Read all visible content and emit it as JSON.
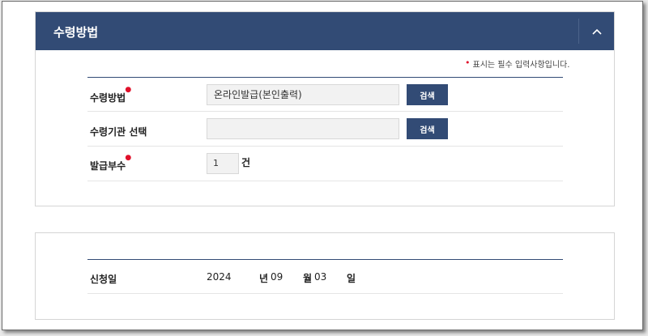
{
  "receive_section": {
    "title": "수령방법",
    "required_note": "표시는 필수 입력사항입니다.",
    "fields": [
      {
        "label": "수령방법",
        "required": true,
        "value": "온라인발급(본인출력)",
        "button": "검색"
      },
      {
        "label": "수령기관 선택",
        "required": false,
        "value": "",
        "button": "검색"
      },
      {
        "label": "발급부수",
        "required": true,
        "value": "1",
        "unit": "건"
      }
    ]
  },
  "application_section": {
    "date_label": "신청일",
    "year": "2024",
    "year_unit": "년",
    "month": "09",
    "month_unit": "월",
    "day": "03",
    "day_unit": "일"
  }
}
